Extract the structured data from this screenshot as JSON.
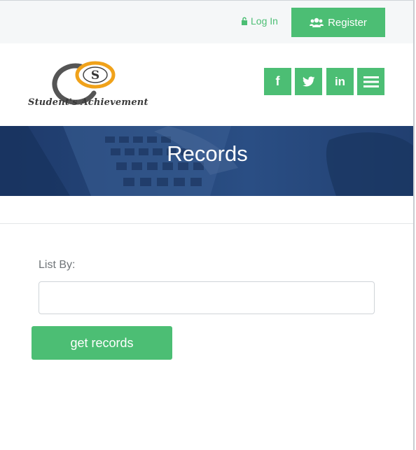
{
  "topbar": {
    "login_label": "Log In",
    "register_label": "Register"
  },
  "header": {
    "logo_letter": "S",
    "logo_text": "Student's Achievement",
    "social": [
      {
        "name": "facebook-icon",
        "glyph": "f"
      },
      {
        "name": "twitter-icon"
      },
      {
        "name": "linkedin-icon",
        "glyph": "in"
      },
      {
        "name": "menu-icon"
      }
    ]
  },
  "hero": {
    "title": "Records"
  },
  "form": {
    "list_by_label": "List By:",
    "list_by_value": "",
    "submit_label": "get records"
  },
  "colors": {
    "accent": "#4cbe74",
    "hero": "#25477a"
  }
}
